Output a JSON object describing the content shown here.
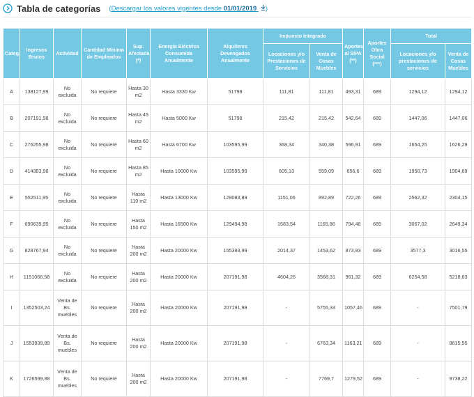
{
  "header": {
    "title": "Tabla de categorías",
    "open_paren": "(",
    "link_prefix": "Descargar los valores vigentes desde ",
    "link_date": "01/01/2019",
    "close_paren": ")"
  },
  "table": {
    "headers": {
      "categ": "Categ.",
      "ingresos": "Ingresos Brutos",
      "actividad": "Actividad",
      "empleados": "Cantidad Mínima de Empleados",
      "superficie": "Sup. Afectada (*)",
      "energia": "Energía Eléctrica Consumida Anualmente",
      "alquileres": "Alquileres Devengados Anualmente",
      "impuesto_group": "Impuesto Integrado",
      "imp_loc": "Locaciones y/o Prestaciones de Servicios",
      "imp_venta": "Venta de Cosas Muebles",
      "sipa": "Aportes al SIPA (**)",
      "obra_social": "Aportes Obra Social (***)",
      "total_group": "Total",
      "tot_loc": "Locaciones y/o prestaciones de servicios",
      "tot_venta": "Venta de Cosas Muebles"
    },
    "rows": [
      {
        "categ": "A",
        "ingresos": "138127,99",
        "actividad": "No excluida",
        "empleados": "No requiere",
        "superficie": "Hasta 30 m2",
        "energia": "Hasta 3330 Kw",
        "alquileres": "51798",
        "imp_loc": "111,81",
        "imp_venta": "111,81",
        "sipa": "493,31",
        "obra_social": "689",
        "tot_loc": "1294,12",
        "tot_venta": "1294,12"
      },
      {
        "categ": "B",
        "ingresos": "207191,98",
        "actividad": "No excluida",
        "empleados": "No requiere",
        "superficie": "Hasta 45 m2",
        "energia": "Hasta 5000 Kw",
        "alquileres": "51798",
        "imp_loc": "215,42",
        "imp_venta": "215,42",
        "sipa": "542,64",
        "obra_social": "689",
        "tot_loc": "1447,06",
        "tot_venta": "1447,06"
      },
      {
        "categ": "C",
        "ingresos": "276255,98",
        "actividad": "No excluida",
        "empleados": "No requiere",
        "superficie": "Hasta 60 m2",
        "energia": "Hasta 6700 Kw",
        "alquileres": "103595,99",
        "imp_loc": "368,34",
        "imp_venta": "340,38",
        "sipa": "596,91",
        "obra_social": "689",
        "tot_loc": "1654,25",
        "tot_venta": "1626,29"
      },
      {
        "categ": "D",
        "ingresos": "414383,98",
        "actividad": "No excluida",
        "empleados": "No requiere",
        "superficie": "Hasta 85 m2",
        "energia": "Hasta 10000 Kw",
        "alquileres": "103595,99",
        "imp_loc": "605,13",
        "imp_venta": "559,09",
        "sipa": "656,6",
        "obra_social": "689",
        "tot_loc": "1950,73",
        "tot_venta": "1904,69"
      },
      {
        "categ": "E",
        "ingresos": "552511,95",
        "actividad": "No excluida",
        "empleados": "No requiere",
        "superficie": "Hasta 110 m2",
        "energia": "Hasta 13000 Kw",
        "alquileres": "129083,89",
        "imp_loc": "1151,06",
        "imp_venta": "892,89",
        "sipa": "722,26",
        "obra_social": "689",
        "tot_loc": "2562,32",
        "tot_venta": "2304,15"
      },
      {
        "categ": "F",
        "ingresos": "690639,95",
        "actividad": "No excluida",
        "empleados": "No requiere",
        "superficie": "Hasta 150 m2",
        "energia": "Hasta 16500 Kw",
        "alquileres": "129494,98",
        "imp_loc": "1583,54",
        "imp_venta": "1165,86",
        "sipa": "794,48",
        "obra_social": "689",
        "tot_loc": "3067,02",
        "tot_venta": "2649,34"
      },
      {
        "categ": "G",
        "ingresos": "828767,94",
        "actividad": "No excluida",
        "empleados": "No requiere",
        "superficie": "Hasta 200 m2",
        "energia": "Hasta 20000 Kw",
        "alquileres": "155393,99",
        "imp_loc": "2014,37",
        "imp_venta": "1453,62",
        "sipa": "873,93",
        "obra_social": "689",
        "tot_loc": "3577,3",
        "tot_venta": "3016,55"
      },
      {
        "categ": "H",
        "ingresos": "1151066,58",
        "actividad": "No excluida",
        "empleados": "No requiere",
        "superficie": "Hasta 200 m2",
        "energia": "Hasta 20000 Kw",
        "alquileres": "207191,98",
        "imp_loc": "4604,26",
        "imp_venta": "3568,31",
        "sipa": "961,32",
        "obra_social": "689",
        "tot_loc": "6254,58",
        "tot_venta": "5218,63"
      },
      {
        "categ": "I",
        "ingresos": "1352503,24",
        "actividad": "Venta de Bs. muebles",
        "empleados": "No requiere",
        "superficie": "Hasta 200 m2",
        "energia": "Hasta 20000 Kw",
        "alquileres": "207191,98",
        "imp_loc": "-",
        "imp_venta": "5755,33",
        "sipa": "1057,46",
        "obra_social": "689",
        "tot_loc": "-",
        "tot_venta": "7501,79"
      },
      {
        "categ": "J",
        "ingresos": "1553939,89",
        "actividad": "Venta de Bs. muebles",
        "empleados": "No requiere",
        "superficie": "Hasta 200 m2",
        "energia": "Hasta 20000 Kw",
        "alquileres": "207191,98",
        "imp_loc": "-",
        "imp_venta": "6763,34",
        "sipa": "1163,21",
        "obra_social": "689",
        "tot_loc": "-",
        "tot_venta": "8615,55"
      },
      {
        "categ": "K",
        "ingresos": "1726599,88",
        "actividad": "Venta de Bs. muebles",
        "empleados": "No requiere",
        "superficie": "Hasta 200 m2",
        "energia": "Hasta 20000 Kw",
        "alquileres": "207191,98",
        "imp_loc": "-",
        "imp_venta": "7769,7",
        "sipa": "1279,52",
        "obra_social": "689",
        "tot_loc": "-",
        "tot_venta": "9738,22"
      }
    ]
  }
}
